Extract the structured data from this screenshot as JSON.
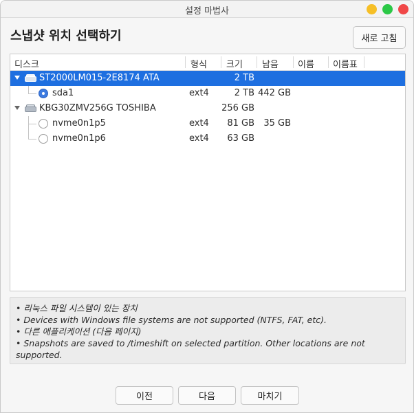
{
  "window": {
    "title": "설정 마법사"
  },
  "heading": "스냅샷 위치 선택하기",
  "refresh_button": "새로 고침",
  "table": {
    "columns": [
      "디스크",
      "형식",
      "크기",
      "남음",
      "이름",
      "이름표"
    ],
    "rows": [
      {
        "kind": "disk",
        "name": "ST2000LM015-2E8174 ATA",
        "type": "",
        "size": "2 TB",
        "free": "",
        "label": "",
        "tag": "",
        "selected": true
      },
      {
        "kind": "partition",
        "name": "sda1",
        "type": "ext4",
        "size": "2 TB",
        "free": "442 GB",
        "label": "",
        "tag": "",
        "checked": true
      },
      {
        "kind": "disk",
        "name": "KBG30ZMV256G TOSHIBA",
        "type": "",
        "size": "256 GB",
        "free": "",
        "label": "",
        "tag": "",
        "selected": false
      },
      {
        "kind": "partition",
        "name": "nvme0n1p5",
        "type": "ext4",
        "size": "81 GB",
        "free": "35 GB",
        "label": "",
        "tag": "",
        "checked": false
      },
      {
        "kind": "partition",
        "name": "nvme0n1p6",
        "type": "ext4",
        "size": "63 GB",
        "free": "",
        "label": "",
        "tag": "",
        "checked": false
      }
    ]
  },
  "notes": [
    "• 리눅스 파일 시스템이 있는 장치",
    "• Devices with Windows file systems are not supported (NTFS, FAT, etc).",
    "• 다른 애플리케이션 (다음 페이지)",
    "• Snapshots are saved to /timeshift on selected partition. Other locations are not supported."
  ],
  "buttons": {
    "prev": "이전",
    "next": "다음",
    "finish": "마치기"
  },
  "colors": {
    "selection": "#1e6fe0",
    "radio_checked": "#3d7be0",
    "close": "#f04747",
    "minimize": "#f6bf26",
    "maximize": "#2bc846"
  }
}
